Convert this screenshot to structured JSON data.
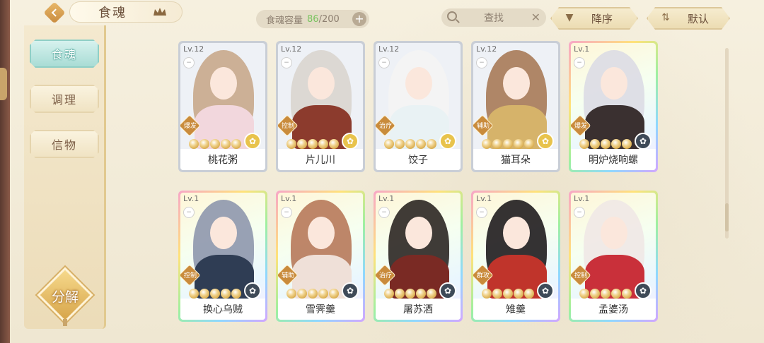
{
  "header": {
    "title": "食魂",
    "capacity_label": "食魂容量",
    "capacity_current": "86",
    "capacity_max": "/200",
    "search_placeholder": "查找",
    "sort_order_label": "降序",
    "sort_mode_label": "默认"
  },
  "sidebar": {
    "items": [
      {
        "label": "食魂",
        "active": true
      },
      {
        "label": "调理",
        "active": false
      },
      {
        "label": "信物",
        "active": false
      }
    ],
    "decompose_label": "分解"
  },
  "cards": [
    {
      "level": "Lv.12",
      "name": "桃花粥",
      "role": "爆发",
      "frame": "silver",
      "emblem": "gold",
      "hair": "#c8a98c",
      "cloth": "#f2d7dd"
    },
    {
      "level": "Lv.12",
      "name": "片儿川",
      "role": "控制",
      "frame": "silver",
      "emblem": "gold",
      "hair": "#d9d5cf",
      "cloth": "#8c3b2d"
    },
    {
      "level": "Lv.12",
      "name": "饺子",
      "role": "治疗",
      "frame": "silver",
      "emblem": "gold",
      "hair": "#f4f4f4",
      "cloth": "#e9f2f4"
    },
    {
      "level": "Lv.12",
      "name": "猫耳朵",
      "role": "辅助",
      "frame": "silver",
      "emblem": "gold",
      "hair": "#a77a58",
      "cloth": "#d6b36a"
    },
    {
      "level": "Lv.1",
      "name": "明炉烧响螺",
      "role": "爆发",
      "frame": "rainbow",
      "emblem": "dark",
      "hair": "#dcdce4",
      "cloth": "#3a3030"
    },
    {
      "level": "Lv.1",
      "name": "换心乌贼",
      "role": "控制",
      "frame": "rainbow",
      "emblem": "dark",
      "hair": "#8e97ad",
      "cloth": "#2f3d54"
    },
    {
      "level": "Lv.1",
      "name": "雪霁羹",
      "role": "辅助",
      "frame": "rainbow",
      "emblem": "dark",
      "hair": "#b7795a",
      "cloth": "#efe0d8"
    },
    {
      "level": "Lv.1",
      "name": "屠苏酒",
      "role": "治疗",
      "frame": "rainbow",
      "emblem": "dark",
      "hair": "#2b2622",
      "cloth": "#7a2a24"
    },
    {
      "level": "Lv.1",
      "name": "雉羹",
      "role": "群攻",
      "frame": "rainbow",
      "emblem": "dark",
      "hair": "#1f1c1e",
      "cloth": "#c0342b"
    },
    {
      "level": "Lv.1",
      "name": "孟婆汤",
      "role": "控制",
      "frame": "rainbow",
      "emblem": "dark",
      "hair": "#efe8e6",
      "cloth": "#c9303a"
    }
  ]
}
